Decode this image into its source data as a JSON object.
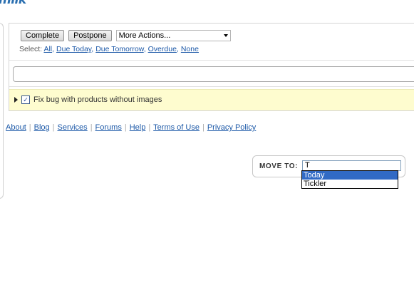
{
  "logo": {
    "text": "milk"
  },
  "toolbar": {
    "complete_label": "Complete",
    "postpone_label": "Postpone",
    "more_actions_label": "More Actions..."
  },
  "select_row": {
    "prefix": "Select:",
    "links": [
      "All",
      "Due Today",
      "Due Tomorrow",
      "Overdue",
      "None"
    ]
  },
  "add_task": {
    "value": ""
  },
  "tasks": [
    {
      "name": "Fix bug with products without images",
      "checked": true
    }
  ],
  "footer": {
    "links": [
      "About",
      "Blog",
      "Services",
      "Forums",
      "Help",
      "Terms of Use",
      "Privacy Policy"
    ]
  },
  "move_to": {
    "label": "MOVE TO:",
    "input_value": "T",
    "suggestions": [
      "Today",
      "Tickler"
    ],
    "highlighted_index": 0
  },
  "colors": {
    "link": "#1d59a8",
    "task_highlight": "#fefccf",
    "suggestion_selected": "#316ac5"
  }
}
